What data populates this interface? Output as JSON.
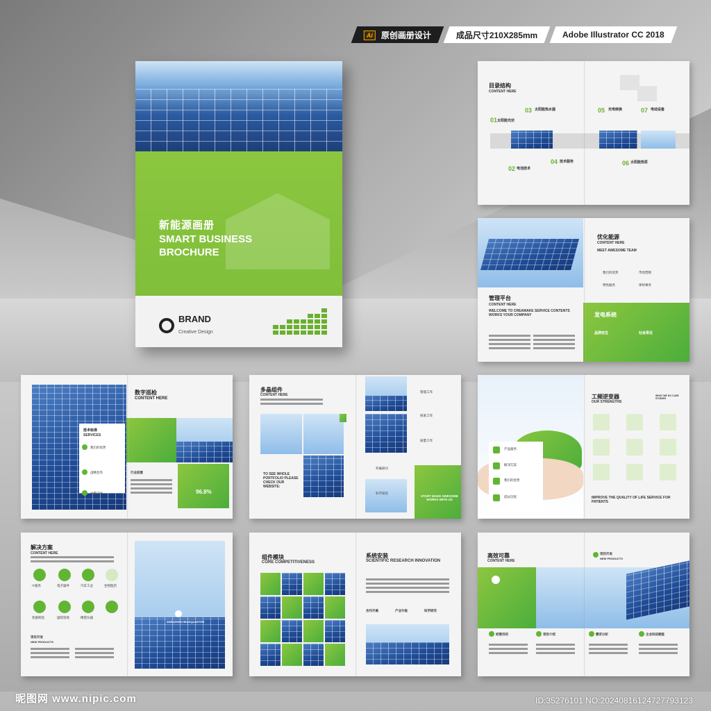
{
  "header": {
    "ai_icon": "Ai",
    "badge1": "原创画册设计",
    "badge2": "成品尺寸210X285mm",
    "badge3": "Adobe Illustrator CC 2018"
  },
  "cover": {
    "title_cn": "新能源画册",
    "title_en": "SMART BUSINESS BROCHURE",
    "brand": "BRAND",
    "brand_sub": "Creative Design"
  },
  "spreads": {
    "toc": {
      "title": "目录结构",
      "sub": "CONTENT HERE",
      "n01": "01",
      "i01": "太阳能光伏",
      "n02": "02",
      "i02": "电池技术",
      "n03": "03",
      "i03": "太阳能热水器",
      "n04": "04",
      "i04": "技术服务",
      "n05": "05",
      "i05": "光电转换",
      "n06": "06",
      "i06": "太阳能热泵",
      "n07": "07",
      "i07": "电动设备"
    },
    "s2": {
      "title": "优化能源",
      "sub": "CONTENT HERE",
      "sub2": "MEET AWESOME TEAM",
      "a": "我们的优势",
      "b": "市场营销",
      "c": "特色服务",
      "d": "律师事务",
      "left_title": "管理平台",
      "left_sub": "CONTENT HERE",
      "left_text": "WELCOME TO CREAMAKE SERVICE CONTENTS WORKS YOUR COMPANY",
      "green_title": "发电系统",
      "g1": "品牌定位",
      "g2": "社会责任"
    },
    "s3": {
      "title": "数字巡检",
      "sub": "CONTENT HERE",
      "svc": "技术标准",
      "svc_en": "SERVICES",
      "a": "我们的优势",
      "b": "战略合作",
      "c": "访客记录",
      "d": "行业前景",
      "pct": "96.8%"
    },
    "s4": {
      "title": "多晶组件",
      "sub": "CONTENT HERE",
      "cta": "TO SEE WHOLE PORTFOLIO PLEASE CHECK OUR WEBSITE:",
      "cta2": "START MAKE AWESOME WORKS WITH US",
      "a": "管理工作",
      "b": "研发工作",
      "c": "质量工作",
      "d": "开展研讨",
      "e": "科学研究"
    },
    "s5": {
      "title": "工频逆变器",
      "sub": "OUR STRENGTHS",
      "tag": "WHAT WE DO CASE STUDIES",
      "a": "产品服务",
      "b": "解决方案",
      "c": "我们的优势",
      "d": "成长历程",
      "bottom": "IMPROVE THE QUALITY OF LIFE SERVICE FOR PATIENTS"
    },
    "s6": {
      "title": "解决方案",
      "sub": "CONTENT HERE",
      "i1": "IT服务",
      "i2": "电子器件",
      "i3": "汽车工业",
      "i4": "生物医药",
      "i5": "装备制造",
      "i6": "国际贸易",
      "i7": "精密仪器",
      "more": "项目开发",
      "more_sub": "NEW PRODUCTS",
      "photo_label": "SHENZHEN HEADQUARTER"
    },
    "s7": {
      "title": "组件模块",
      "sub": "CORE COMPETITIVENESS",
      "title2": "系统安装",
      "sub2": "SCIENTIFIC RESEARCH INNOVATION",
      "c1": "合作开展",
      "c2": "产业升级",
      "c3": "科学研究"
    },
    "s8": {
      "title": "高效可靠",
      "sub": "CONTENT HERE",
      "proj": "项目开发",
      "proj_sub": "NEW PRODUCTS",
      "a": "经营目的",
      "b": "项目介绍",
      "c": "需求分析",
      "d": "企业科技赋能"
    }
  },
  "footer": {
    "watermark": "昵图网 www.nipic.com",
    "id": "ID:35276101 NO:20240816124727793123"
  },
  "colors": {
    "accent": "#6ab02e",
    "blue": "#1e4b96"
  }
}
